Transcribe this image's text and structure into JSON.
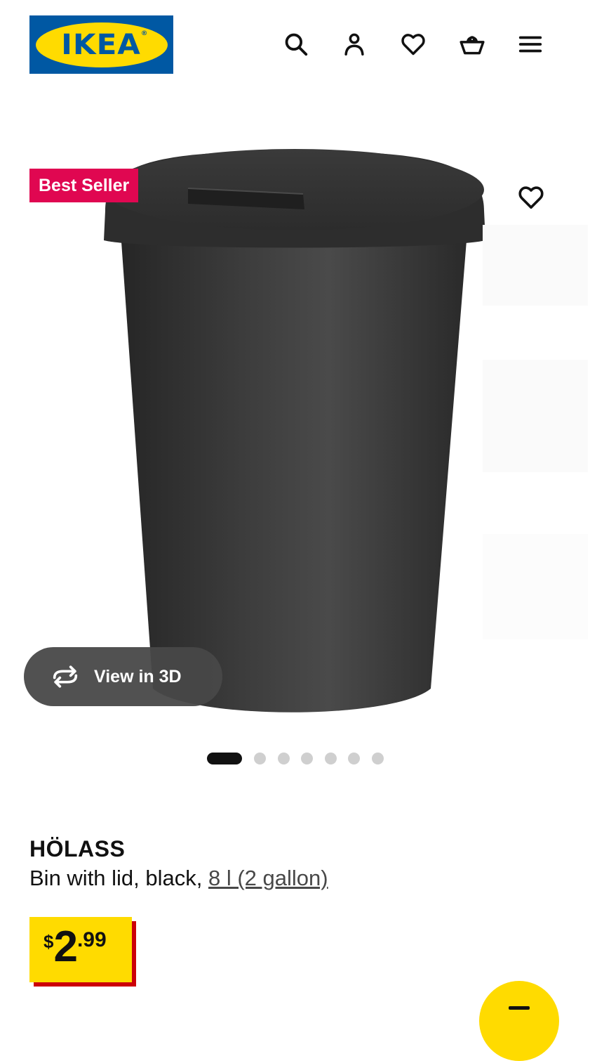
{
  "header": {
    "logo_text": "IKEA",
    "logo_registered": "®",
    "icons": [
      "search-icon",
      "account-icon",
      "heart-icon",
      "basket-icon",
      "menu-icon"
    ]
  },
  "gallery": {
    "badge": "Best Seller",
    "view_3d_label": "View in 3D",
    "slide_count": 7,
    "active_slide": 1
  },
  "product": {
    "name": "HÖLASS",
    "description": "Bin with lid, black, ",
    "size_link": "8 l (2 gallon)",
    "price": {
      "currency": "$",
      "integer": "2",
      "decimal": ".99"
    }
  },
  "colors": {
    "ikea_blue": "#0058a3",
    "ikea_yellow": "#ffdb00",
    "badge_red": "#e00751",
    "price_shadow": "#cc0008"
  }
}
